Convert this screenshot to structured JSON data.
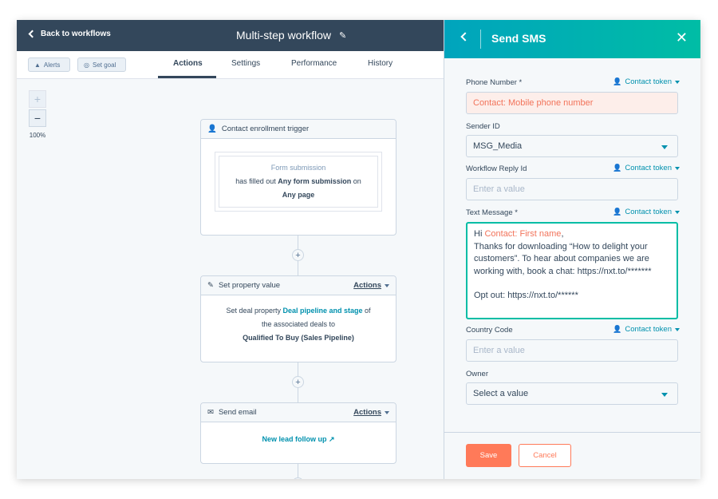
{
  "header": {
    "back_label": "Back to workflows",
    "workflow_title": "Multi-step workflow"
  },
  "toolbar": {
    "alerts_label": "Alerts",
    "set_goal_label": "Set goal",
    "tabs": [
      {
        "label": "Actions",
        "active": true
      },
      {
        "label": "Settings",
        "active": false
      },
      {
        "label": "Performance",
        "active": false
      },
      {
        "label": "History",
        "active": false
      }
    ]
  },
  "zoom": {
    "plus": "+",
    "minus": "−",
    "level": "100%"
  },
  "cards": {
    "trigger": {
      "title": "Contact enrollment trigger",
      "type": "Form submission",
      "line1_pre": "has filled out ",
      "line1_bold": "Any form submission",
      "line1_post": " on",
      "line2_bold": "Any page"
    },
    "set_property": {
      "title": "Set property value",
      "actions_label": "Actions",
      "line1_pre": "Set deal property ",
      "line1_link": "Deal pipeline and stage",
      "line1_post": " of",
      "line2": "the associated deals to",
      "line3": "Qualified To Buy (Sales Pipeline)"
    },
    "send_email": {
      "title": "Send email",
      "actions_label": "Actions",
      "link": "New lead follow up"
    }
  },
  "panel": {
    "title": "Send SMS",
    "fields": {
      "phone": {
        "label": "Phone Number *",
        "token": "Contact token",
        "value": "Contact: Mobile phone number"
      },
      "sender": {
        "label": "Sender ID",
        "value": "MSG_Media"
      },
      "reply": {
        "label": "Workflow Reply Id",
        "token": "Contact token",
        "placeholder": "Enter a value"
      },
      "text": {
        "label": "Text Message *",
        "token": "Contact token",
        "greeting": "Hi ",
        "token_inline": "Contact: First name",
        "after_token": ",",
        "body": "Thanks for downloading “How to delight your customers”. To hear about companies we are working with, book a chat: https://nxt.to/*******",
        "optout": "Opt out: https://nxt.to/******"
      },
      "country": {
        "label": "Country Code",
        "token": "Contact token",
        "placeholder": "Enter a value"
      },
      "owner": {
        "label": "Owner",
        "value": "Select a value"
      }
    },
    "save_label": "Save",
    "cancel_label": "Cancel"
  },
  "colors": {
    "header_bg": "#33475b",
    "accent_teal": "#00bda5",
    "accent_orange": "#ff7a59",
    "link_blue": "#0091ae"
  }
}
